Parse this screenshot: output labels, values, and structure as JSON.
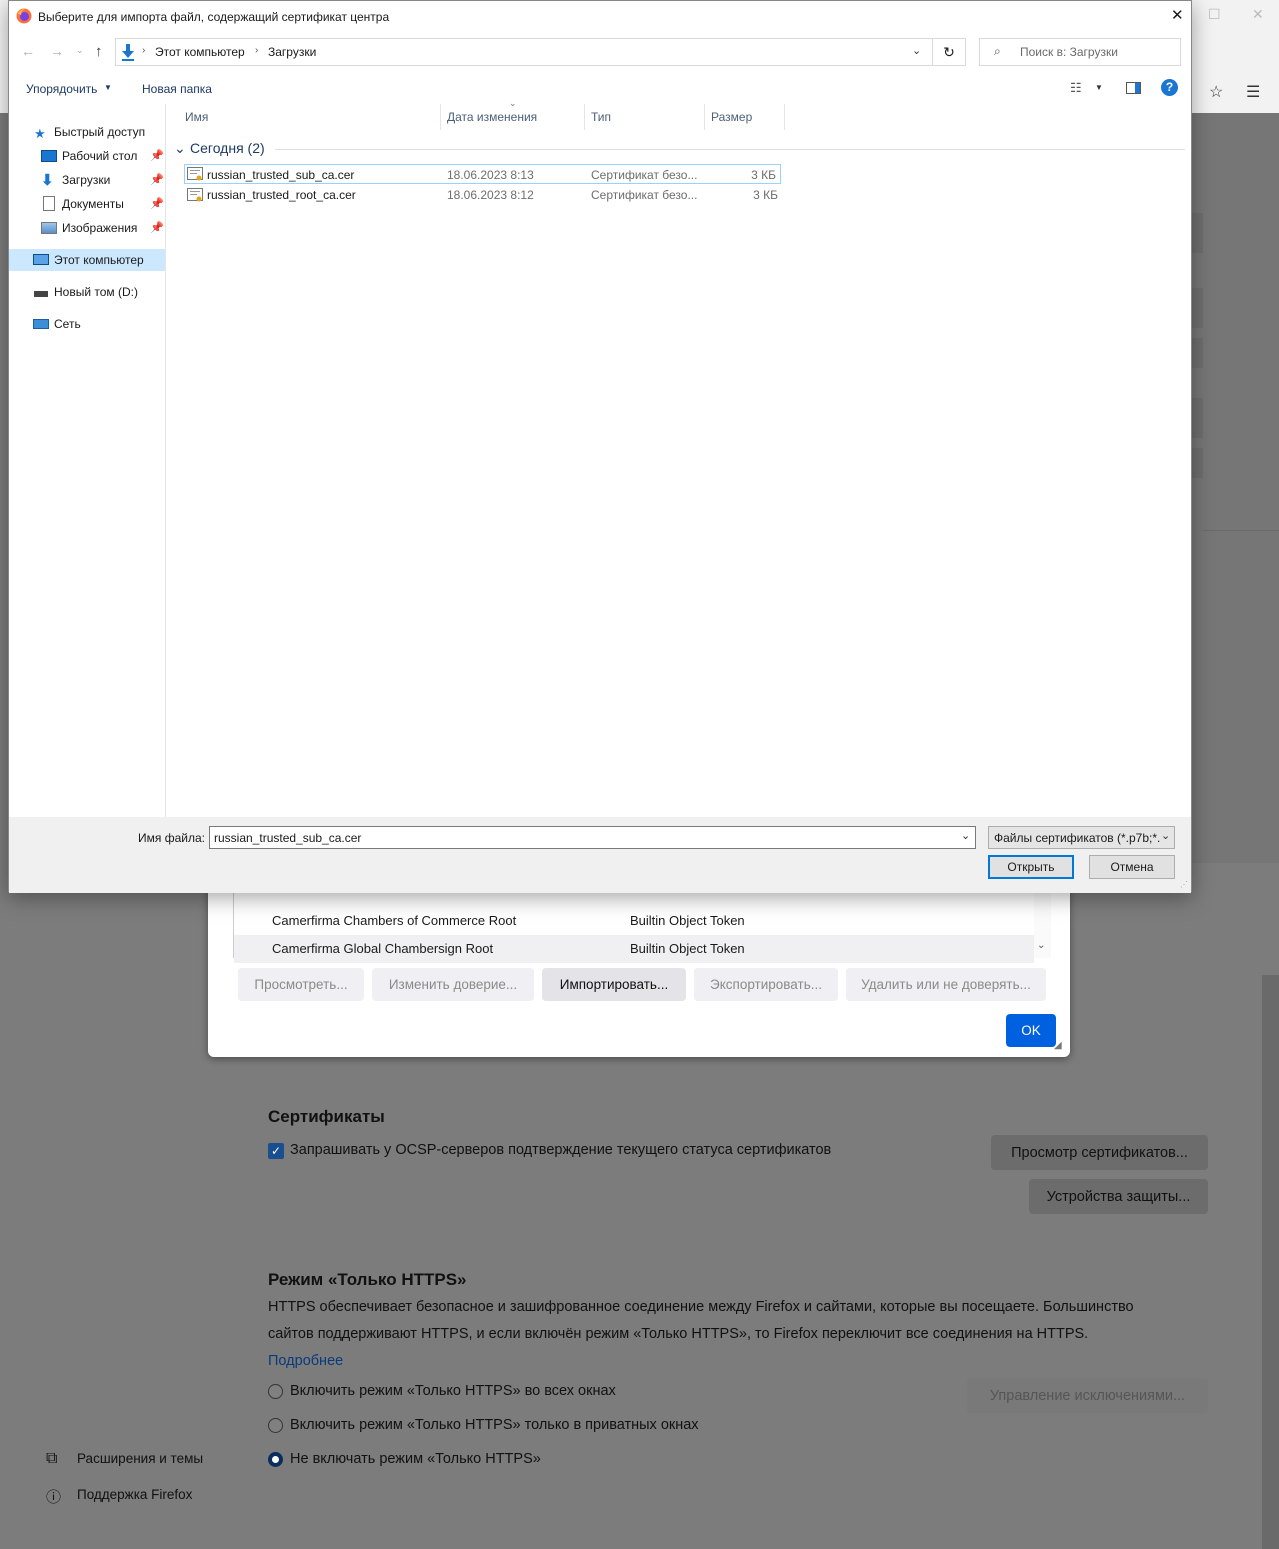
{
  "dialog": {
    "title": "Выберите для импорта файл, содержащий сертификат центра",
    "breadcrumb": [
      "Этот компьютер",
      "Загрузки"
    ],
    "search_placeholder": "Поиск в: Загрузки",
    "organize_label": "Упорядочить",
    "new_folder_label": "Новая папка",
    "nav": {
      "quick_access": "Быстрый доступ",
      "desktop": "Рабочий стол",
      "downloads": "Загрузки",
      "documents": "Документы",
      "images": "Изображения",
      "this_pc": "Этот компьютер",
      "drive": "Новый том (D:)",
      "network": "Сеть"
    },
    "columns": {
      "name": "Имя",
      "date": "Дата изменения",
      "type": "Тип",
      "size": "Размер"
    },
    "group_label": "Сегодня (2)",
    "files": [
      {
        "name": "russian_trusted_sub_ca.cer",
        "date": "18.06.2023 8:13",
        "type": "Сертификат безо...",
        "size": "3 КБ"
      },
      {
        "name": "russian_trusted_root_ca.cer",
        "date": "18.06.2023 8:12",
        "type": "Сертификат безо...",
        "size": "3 КБ"
      }
    ],
    "filename_label": "Имя файла:",
    "filename_value": "russian_trusted_sub_ca.cer",
    "filetype_value": "Файлы сертификатов (*.p7b;*.",
    "open_label": "Открыть",
    "cancel_label": "Отмена"
  },
  "cert_manager": {
    "rows": [
      {
        "name": "Camerfirma Chambers of Commerce Root",
        "device": "Builtin Object Token"
      },
      {
        "name": "Camerfirma Global Chambersign Root",
        "device": "Builtin Object Token"
      }
    ],
    "buttons": {
      "view": "Просмотреть...",
      "edit": "Изменить доверие...",
      "import": "Импортировать...",
      "export": "Экспортировать...",
      "delete": "Удалить или не доверять..."
    },
    "ok_label": "OK"
  },
  "settings": {
    "certs_heading": "Сертификаты",
    "ocsp_label": "Запрашивать у OCSP-серверов подтверждение текущего статуса сертификатов",
    "ocsp_checked": true,
    "view_certs_button": "Просмотр сертификатов...",
    "security_devices_button": "Устройства защиты...",
    "https_heading": "Режим «Только HTTPS»",
    "https_desc_line1": "HTTPS обеспечивает безопасное и зашифрованное соединение между Firefox и сайтами, которые вы посещаете. Большинство",
    "https_desc_line2": "сайтов поддерживают HTTPS, и если включён режим «Только HTTPS», то Firefox переключит все соединения на HTTPS.",
    "learn_more": "Подробнее",
    "radio_all": "Включить режим «Только HTTPS» во всех окнах",
    "radio_private": "Включить режим «Только HTTPS» только в приватных окнах",
    "radio_off": "Не включать режим «Только HTTPS»",
    "manage_exceptions": "Управление исключениями...",
    "sidebar_extensions": "Расширения и темы",
    "sidebar_support": "Поддержка Firefox"
  }
}
